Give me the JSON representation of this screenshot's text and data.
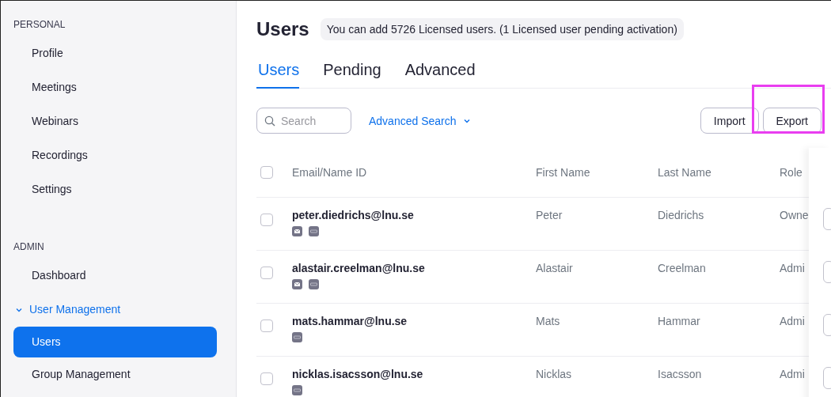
{
  "sidebar": {
    "sections": [
      {
        "heading": "PERSONAL",
        "items": [
          {
            "label": "Profile",
            "selected": false
          },
          {
            "label": "Meetings",
            "selected": false
          },
          {
            "label": "Webinars",
            "selected": false
          },
          {
            "label": "Recordings",
            "selected": false
          },
          {
            "label": "Settings",
            "selected": false
          }
        ]
      },
      {
        "heading": "ADMIN",
        "items": [
          {
            "label": "Dashboard",
            "selected": false
          },
          {
            "label": "User Management",
            "selected": false,
            "expanded": true,
            "children": [
              {
                "label": "Users",
                "selected": true
              },
              {
                "label": "Group Management",
                "selected": false
              }
            ]
          }
        ]
      }
    ]
  },
  "page": {
    "title": "Users",
    "notice": "You can add 5726 Licensed users. (1 Licensed user pending activation)"
  },
  "tabs": [
    {
      "label": "Users",
      "selected": true
    },
    {
      "label": "Pending",
      "selected": false
    },
    {
      "label": "Advanced",
      "selected": false
    }
  ],
  "toolbar": {
    "search": {
      "placeholder": "Search"
    },
    "advanced_search": "Advanced Search",
    "buttons": [
      {
        "label": "Import",
        "highlighted": false
      },
      {
        "label": "Export",
        "highlighted": true
      }
    ]
  },
  "table": {
    "select_all_checked": false,
    "columns": [
      "Email/Name ID",
      "First Name",
      "Last Name",
      "Role"
    ],
    "rows": [
      {
        "checked": false,
        "email": "peter.diedrichs@lnu.se",
        "icons": [
          {
            "kind": "mail"
          },
          {
            "kind": "sso"
          }
        ],
        "first_name": "Peter",
        "last_name": "Diedrichs",
        "role": "Owne"
      },
      {
        "checked": false,
        "email": "alastair.creelman@lnu.se",
        "icons": [
          {
            "kind": "mail"
          },
          {
            "kind": "sso"
          }
        ],
        "first_name": "Alastair",
        "last_name": "Creelman",
        "role": "Admi"
      },
      {
        "checked": false,
        "email": "mats.hammar@lnu.se",
        "icons": [
          {
            "kind": "sso"
          }
        ],
        "first_name": "Mats",
        "last_name": "Hammar",
        "role": "Admi"
      },
      {
        "checked": false,
        "email": "nicklas.isacsson@lnu.se",
        "icons": [
          {
            "kind": "sso"
          }
        ],
        "first_name": "Nicklas",
        "last_name": "Isacsson",
        "role": "Admi"
      }
    ]
  }
}
